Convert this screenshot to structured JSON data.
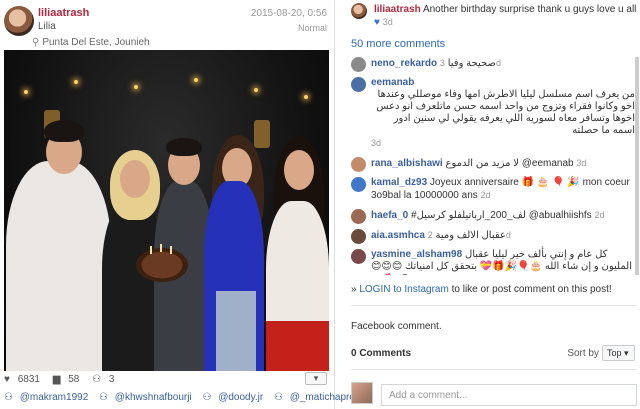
{
  "post": {
    "username": "liliaatrash",
    "full_name": "Lilia",
    "date": "2015-08-20, 0:56",
    "filter": "Normal",
    "location": "Punta Del Este, Jounieh",
    "likes": "6831",
    "comments_count": "58",
    "other_count": "3",
    "more_button": "▾",
    "tags": [
      "@makram1992",
      "@khwshnafbourji",
      "@doody.jr",
      "@_matichapretty_"
    ]
  },
  "caption": {
    "username": "liliaatrash",
    "text": "Another birthday surprise thank u guys love u all",
    "heart": "♥",
    "age": "3d"
  },
  "more_comments": "50 more comments",
  "comments": [
    {
      "user": "neno_rekardo",
      "text": "صحيحة وفيا",
      "age": "3d",
      "rtl": false,
      "color": "#8a8a8a"
    },
    {
      "user": "eemanab",
      "text": "من يعرف اسم مسلسل ليليا الاطرش امها وفاء موصللي وعندها اخو وكانوا فقراء وتزوج من واحد اسمه حسن ماتلعرف انو دعس اخوها وتسافر معاه لسوريه اللي يعرفه يقولي لي سنين ادور اسمه ما حصلته",
      "age": "3d",
      "rtl": true,
      "color": "#4a6fa5"
    },
    {
      "user": "rana_albishawi",
      "text": "لا مزيد من الدموع @eemanab",
      "age": "3d",
      "rtl": false,
      "color": "#c48b6a"
    },
    {
      "user": "kamal_dz93",
      "text": "Joyeux anniversaire 🎁 🎂 🎈 🎉 mon coeur 3o9bal la 10000000 ans",
      "age": "2d",
      "rtl": false,
      "color": "#3f78c9"
    },
    {
      "user": "haefa_0",
      "text": "#لف_200_ارباتيلفلو كرسيل @abualhiishfs",
      "age": "2d",
      "rtl": false,
      "color": "#9b6a55"
    },
    {
      "user": "aia.asmhca",
      "text": "عقبال الالف ومية",
      "age": "2d",
      "rtl": false,
      "color": "#6b4a3a"
    },
    {
      "user": "yasmine_alsham98",
      "text": "كل عام و إنتي بألف خير ليليا عقبال المليون و إن شاء الله 🎂🎈🎉🎁💝 بتحقق كل امنياتك 😊😊😊😘❤💕",
      "age": "2d",
      "rtl": false,
      "color": "#7a4a4a"
    },
    {
      "user": "",
      "text": "",
      "age": "",
      "rtl": false,
      "color": "#a87"
    }
  ],
  "login": {
    "link": "LOGIN to Instagram",
    "rest": " to like or post comment on this post!"
  },
  "fb": {
    "title": "Facebook comment.",
    "count": "0 Comments",
    "sort_label": "Sort by",
    "sort_value": "Top",
    "input_placeholder": "Add a comment..."
  }
}
